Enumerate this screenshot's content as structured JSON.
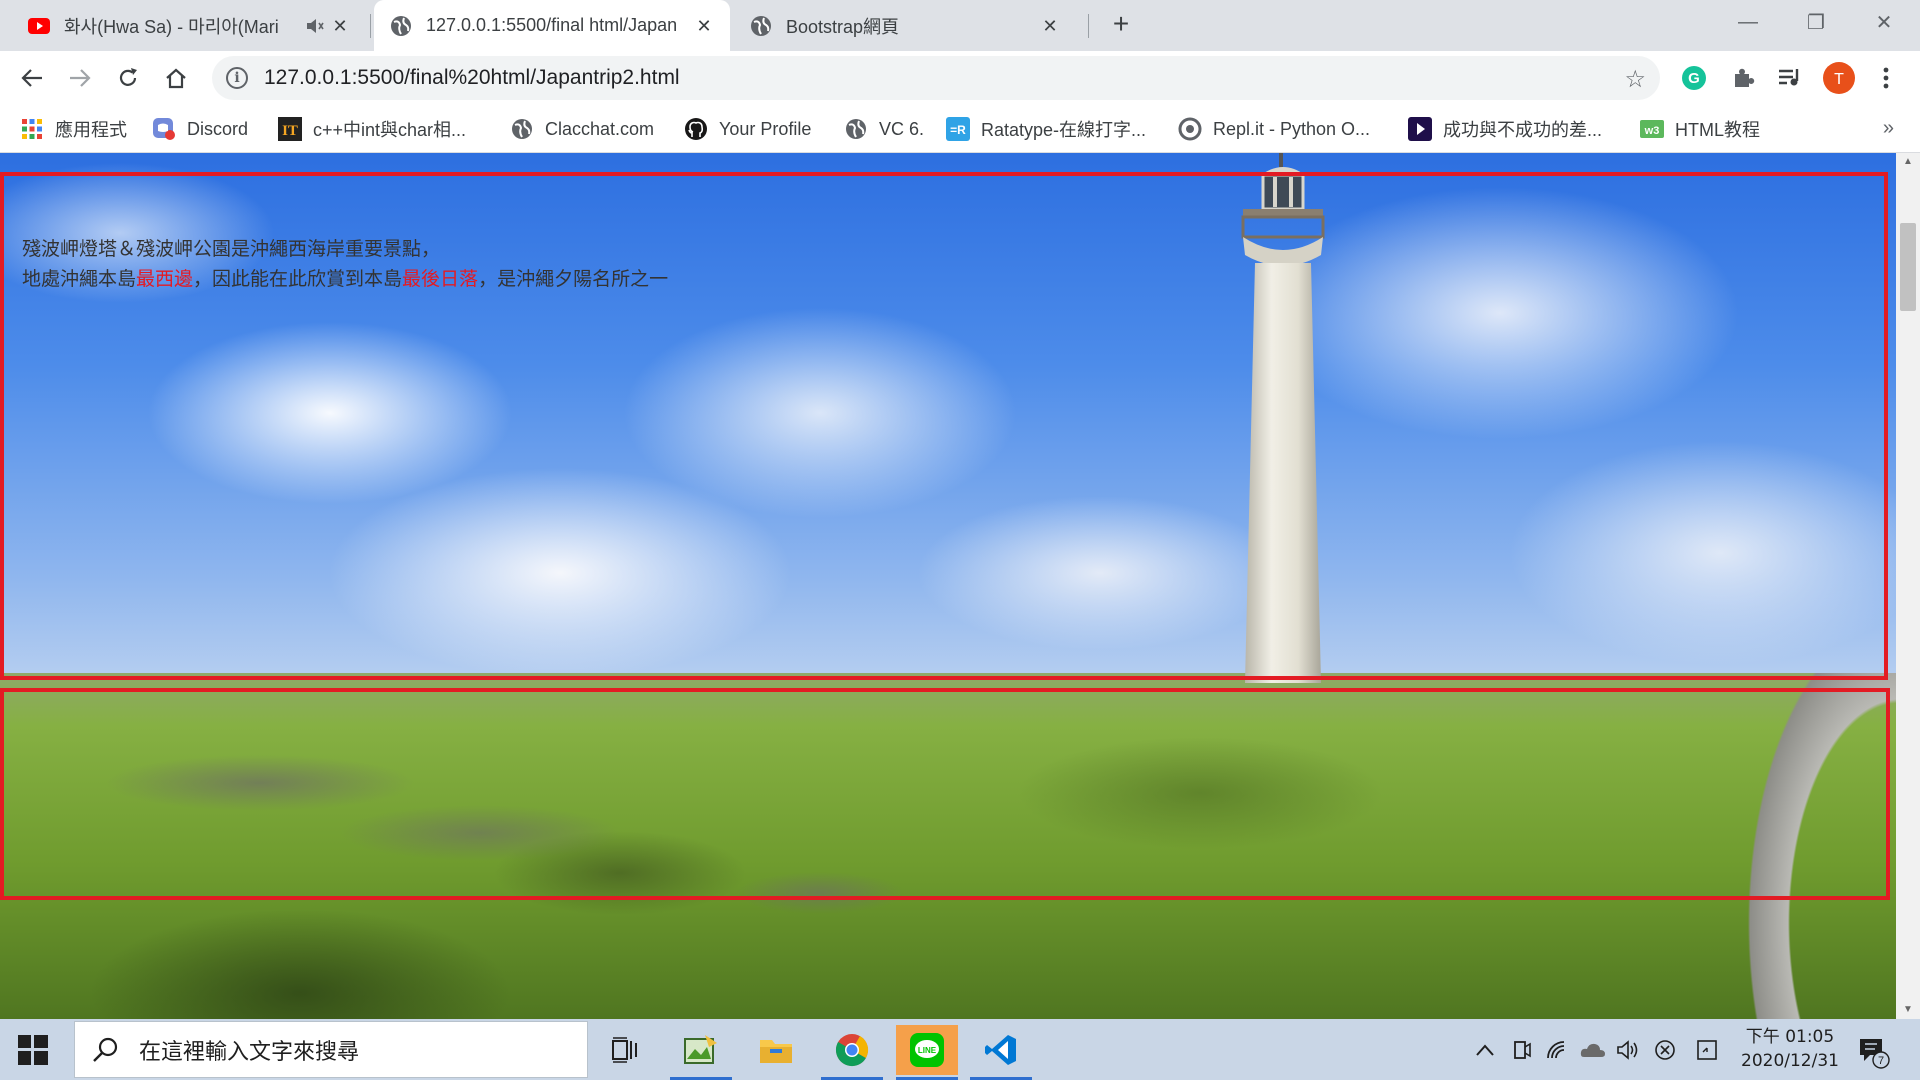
{
  "browser": {
    "tabs": [
      {
        "title": "화사(Hwa Sa) - 마리아(Mari",
        "favicon": "youtube-icon",
        "muted_audio": true
      },
      {
        "title": "127.0.0.1:5500/final html/Japan",
        "favicon": "globe-icon",
        "active": true
      },
      {
        "title": "Bootstrap網頁",
        "favicon": "globe-icon"
      }
    ],
    "new_tab": "+",
    "window_controls": {
      "minimize": "—",
      "restore": "❐",
      "close": "✕"
    },
    "url": "127.0.0.1:5500/final%20html/Japantrip2.html",
    "profile_initial": "T",
    "bookmarks": [
      {
        "label": "應用程式",
        "icon": "apps-grid-icon"
      },
      {
        "label": "Discord",
        "icon": "discord-icon"
      },
      {
        "label": "c++中int與char相...",
        "icon": "ithome-icon"
      },
      {
        "label": "Clacchat.com",
        "icon": "globe-icon"
      },
      {
        "label": "Your Profile",
        "icon": "github-icon"
      },
      {
        "label": "VC 6.",
        "icon": "globe-icon"
      },
      {
        "label": "Ratatype-在線打字...",
        "icon": "ratatype-icon"
      },
      {
        "label": "Repl.it - Python O...",
        "icon": "replit-icon"
      },
      {
        "label": "成功與不成功的差...",
        "icon": "video-icon"
      },
      {
        "label": "HTML教程",
        "icon": "w3-icon"
      }
    ],
    "bookmarks_more": "»"
  },
  "page": {
    "intro_line1": "殘波岬燈塔＆殘波岬公園是沖繩西海岸重要景點，",
    "intro_line2_a": "地處沖繩本島",
    "intro_line2_red1": "最西邊",
    "intro_line2_b": "，因此能在此欣賞到本島",
    "intro_line2_red2": "最後日落",
    "intro_line2_c": "，是沖繩夕陽名所之一",
    "accent_color": "#e31b23"
  },
  "taskbar": {
    "search_placeholder": "在這裡輸入文字來搜尋",
    "apps": [
      "task-view-icon",
      "paint-icon",
      "file-explorer-icon",
      "chrome-icon",
      "line-icon",
      "vscode-icon"
    ],
    "clock_time": "下午 01:05",
    "clock_date": "2020/12/31",
    "notification_count": "7"
  }
}
